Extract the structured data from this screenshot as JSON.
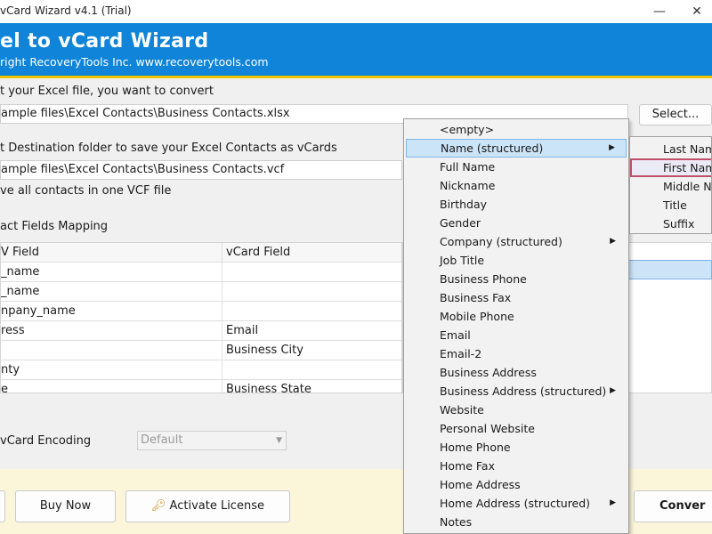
{
  "window": {
    "title": "vCard Wizard v4.1 (Trial)",
    "minimize_glyph": "—",
    "close_glyph": "✕"
  },
  "banner": {
    "title": "el to vCard Wizard",
    "copyright": "right RecoveryTools Inc. www.recoverytools.com"
  },
  "source": {
    "label": "t your Excel file, you want to convert",
    "path": "ample files\\Excel Contacts\\Business Contacts.xlsx",
    "select_label": "Select..."
  },
  "destination": {
    "label": "t Destination folder to save your Excel Contacts as vCards",
    "path": "ample files\\Excel Contacts\\Business Contacts.vcf"
  },
  "options": {
    "single_vcf_label": "ve all contacts in one VCF file"
  },
  "mapping": {
    "section_label": "act Fields Mapping",
    "headers": [
      "V Field",
      "vCard Field"
    ],
    "rows": [
      [
        "_name",
        ""
      ],
      [
        "_name",
        ""
      ],
      [
        "npany_name",
        ""
      ],
      [
        "ress",
        "Email"
      ],
      [
        "",
        "Business City"
      ],
      [
        "nty",
        ""
      ],
      [
        "e",
        "Business State"
      ]
    ]
  },
  "encoding": {
    "label": "vCard Encoding",
    "value": "Default"
  },
  "buttons": {
    "buy_now": "Buy Now",
    "activate_license": "Activate License",
    "convert": "Conver"
  },
  "context_menu": {
    "items": [
      {
        "label": "<empty>",
        "submenu": false
      },
      {
        "label": "Name (structured)",
        "submenu": true,
        "active": true
      },
      {
        "label": "Full Name",
        "submenu": false
      },
      {
        "label": "Nickname",
        "submenu": false
      },
      {
        "label": "Birthday",
        "submenu": false
      },
      {
        "label": "Gender",
        "submenu": false
      },
      {
        "label": "Company (structured)",
        "submenu": true
      },
      {
        "label": "Job Title",
        "submenu": false
      },
      {
        "label": "Business Phone",
        "submenu": false
      },
      {
        "label": "Business Fax",
        "submenu": false
      },
      {
        "label": "Mobile Phone",
        "submenu": false
      },
      {
        "label": "Email",
        "submenu": false
      },
      {
        "label": "Email-2",
        "submenu": false
      },
      {
        "label": "Business Address",
        "submenu": false
      },
      {
        "label": "Business Address (structured)",
        "submenu": true
      },
      {
        "label": "Website",
        "submenu": false
      },
      {
        "label": "Personal Website",
        "submenu": false
      },
      {
        "label": "Home Phone",
        "submenu": false
      },
      {
        "label": "Home Fax",
        "submenu": false
      },
      {
        "label": "Home Address",
        "submenu": false
      },
      {
        "label": "Home Address (structured)",
        "submenu": true
      },
      {
        "label": "Notes",
        "submenu": false
      }
    ],
    "submenu_items": [
      {
        "label": "Last Nam"
      },
      {
        "label": "First Nam",
        "active": true
      },
      {
        "label": "Middle N"
      },
      {
        "label": "Title"
      },
      {
        "label": "Suffix"
      }
    ],
    "submenu_arrow_glyph": "▶"
  },
  "colors": {
    "banner_blue": "#0f84d8",
    "banner_accent": "#f5c400",
    "menu_highlight": "#cce4f7",
    "submenu_focus_border": "#c0506b"
  }
}
